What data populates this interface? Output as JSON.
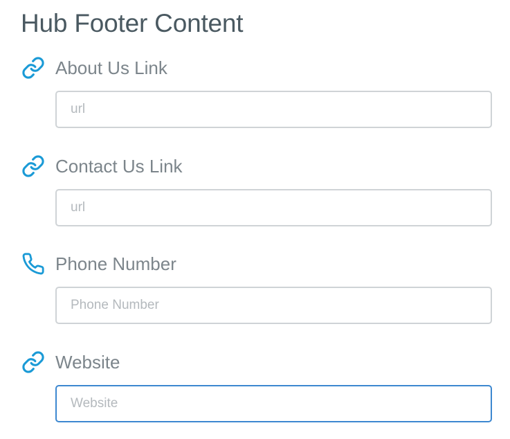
{
  "title": "Hub Footer Content",
  "fields": [
    {
      "label": "About Us Link",
      "placeholder": "url",
      "value": "",
      "icon": "link-icon"
    },
    {
      "label": "Contact Us Link",
      "placeholder": "url",
      "value": "",
      "icon": "link-icon"
    },
    {
      "label": "Phone Number",
      "placeholder": "Phone Number",
      "value": "",
      "icon": "phone-icon"
    },
    {
      "label": "Website",
      "placeholder": "Website",
      "value": "",
      "icon": "link-icon"
    }
  ],
  "colors": {
    "icon": "#1a9ad6",
    "focus_border": "#3c87d0",
    "title": "#4a5961",
    "label": "#7c858b"
  }
}
